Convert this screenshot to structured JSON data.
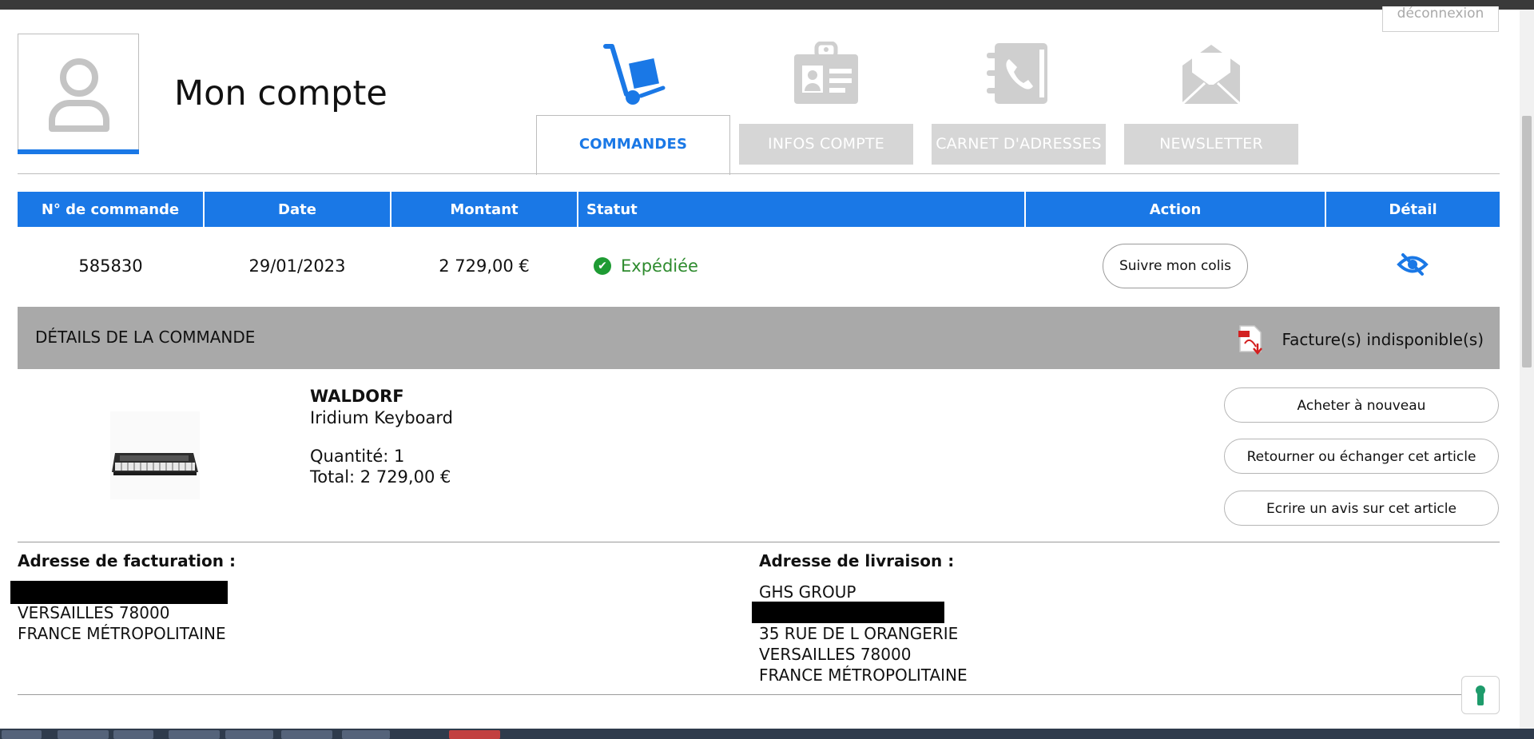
{
  "header": {
    "logout_label": "déconnexion",
    "page_title": "Mon compte"
  },
  "tabs": [
    {
      "label": "COMMANDES",
      "icon": "hand-truck-icon",
      "active": true
    },
    {
      "label": "INFOS COMPTE",
      "icon": "id-card-icon",
      "active": false
    },
    {
      "label": "CARNET D'ADRESSES",
      "icon": "address-book-icon",
      "active": false
    },
    {
      "label": "NEWSLETTER",
      "icon": "envelope-icon",
      "active": false
    }
  ],
  "orders_table": {
    "columns": [
      "N° de commande",
      "Date",
      "Montant",
      "Statut",
      "Action",
      "Détail"
    ],
    "rows": [
      {
        "order_number": "585830",
        "date": "29/01/2023",
        "amount": "2 729,00 €",
        "status": "Expédiée",
        "action_label": "Suivre mon colis",
        "detail_icon": "eye-slash-icon"
      }
    ]
  },
  "details": {
    "title": "DÉTAILS DE LA COMMANDE",
    "invoice_label": "Facture(s) indisponible(s)",
    "invoice_icon": "pdf-download-icon"
  },
  "product": {
    "brand": "WALDORF",
    "name": "Iridium Keyboard",
    "quantity": "Quantité: 1",
    "total": "Total: 2 729,00 €",
    "image": "synthesizer-keyboard-image"
  },
  "product_actions": [
    "Acheter à nouveau",
    "Retourner ou échanger cet article",
    "Ecrire un avis sur cet article"
  ],
  "billing_address": {
    "heading": "Adresse de facturation :",
    "lines": [
      "VERSAILLES 78000",
      "FRANCE MÉTROPOLITAINE"
    ]
  },
  "shipping_address": {
    "heading": "Adresse de livraison :",
    "company": "GHS GROUP",
    "lines": [
      "35 RUE DE L ORANGERIE",
      "VERSAILLES 78000",
      "FRANCE MÉTROPOLITAINE"
    ]
  },
  "colors": {
    "accent": "#1a78e6",
    "tab_inactive": "#d6d6d6",
    "details_bar": "#a9a9a9",
    "status_green": "#1e9b33"
  }
}
